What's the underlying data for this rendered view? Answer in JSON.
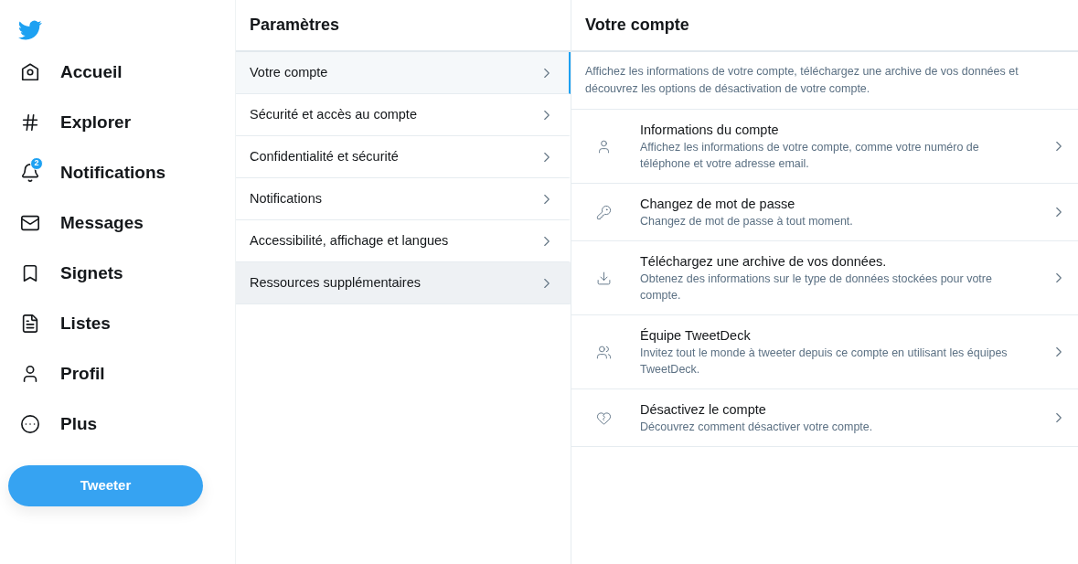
{
  "nav": {
    "items": [
      {
        "kind": "home",
        "label": "Accueil"
      },
      {
        "kind": "explore",
        "label": "Explorer"
      },
      {
        "kind": "notifications",
        "label": "Notifications",
        "badge": "2"
      },
      {
        "kind": "messages",
        "label": "Messages"
      },
      {
        "kind": "bookmarks",
        "label": "Signets"
      },
      {
        "kind": "lists",
        "label": "Listes"
      },
      {
        "kind": "profile",
        "label": "Profil"
      },
      {
        "kind": "more",
        "label": "Plus"
      }
    ],
    "tweet_button": "Tweeter"
  },
  "settings": {
    "title": "Paramètres",
    "items": [
      {
        "label": "Votre compte",
        "selected": true,
        "hovered": false
      },
      {
        "label": "Sécurité et accès au compte",
        "selected": false,
        "hovered": false
      },
      {
        "label": "Confidentialité et sécurité",
        "selected": false,
        "hovered": false
      },
      {
        "label": "Notifications",
        "selected": false,
        "hovered": false
      },
      {
        "label": "Accessibilité, affichage et langues",
        "selected": false,
        "hovered": false
      },
      {
        "label": "Ressources supplémentaires",
        "selected": false,
        "hovered": true
      }
    ]
  },
  "account": {
    "title": "Votre compte",
    "description": "Affichez les informations de votre compte, téléchargez une archive de vos données et découvrez les options de désactivation de votre compte.",
    "items": [
      {
        "kind": "user",
        "title": "Informations du compte",
        "subtitle": "Affichez les informations de votre compte, comme votre numéro de téléphone et votre adresse email."
      },
      {
        "kind": "key",
        "title": "Changez de mot de passe",
        "subtitle": "Changez de mot de passe à tout moment."
      },
      {
        "kind": "download",
        "title": "Téléchargez une archive de vos données.",
        "subtitle": "Obtenez des informations sur le type de données stockées pour votre compte."
      },
      {
        "kind": "team",
        "title": "Équipe TweetDeck",
        "subtitle": "Invitez tout le monde à tweeter depuis ce compte en utilisant les équipes TweetDeck."
      },
      {
        "kind": "heart",
        "title": "Désactivez le compte",
        "subtitle": "Découvrez comment désactiver votre compte."
      }
    ]
  }
}
